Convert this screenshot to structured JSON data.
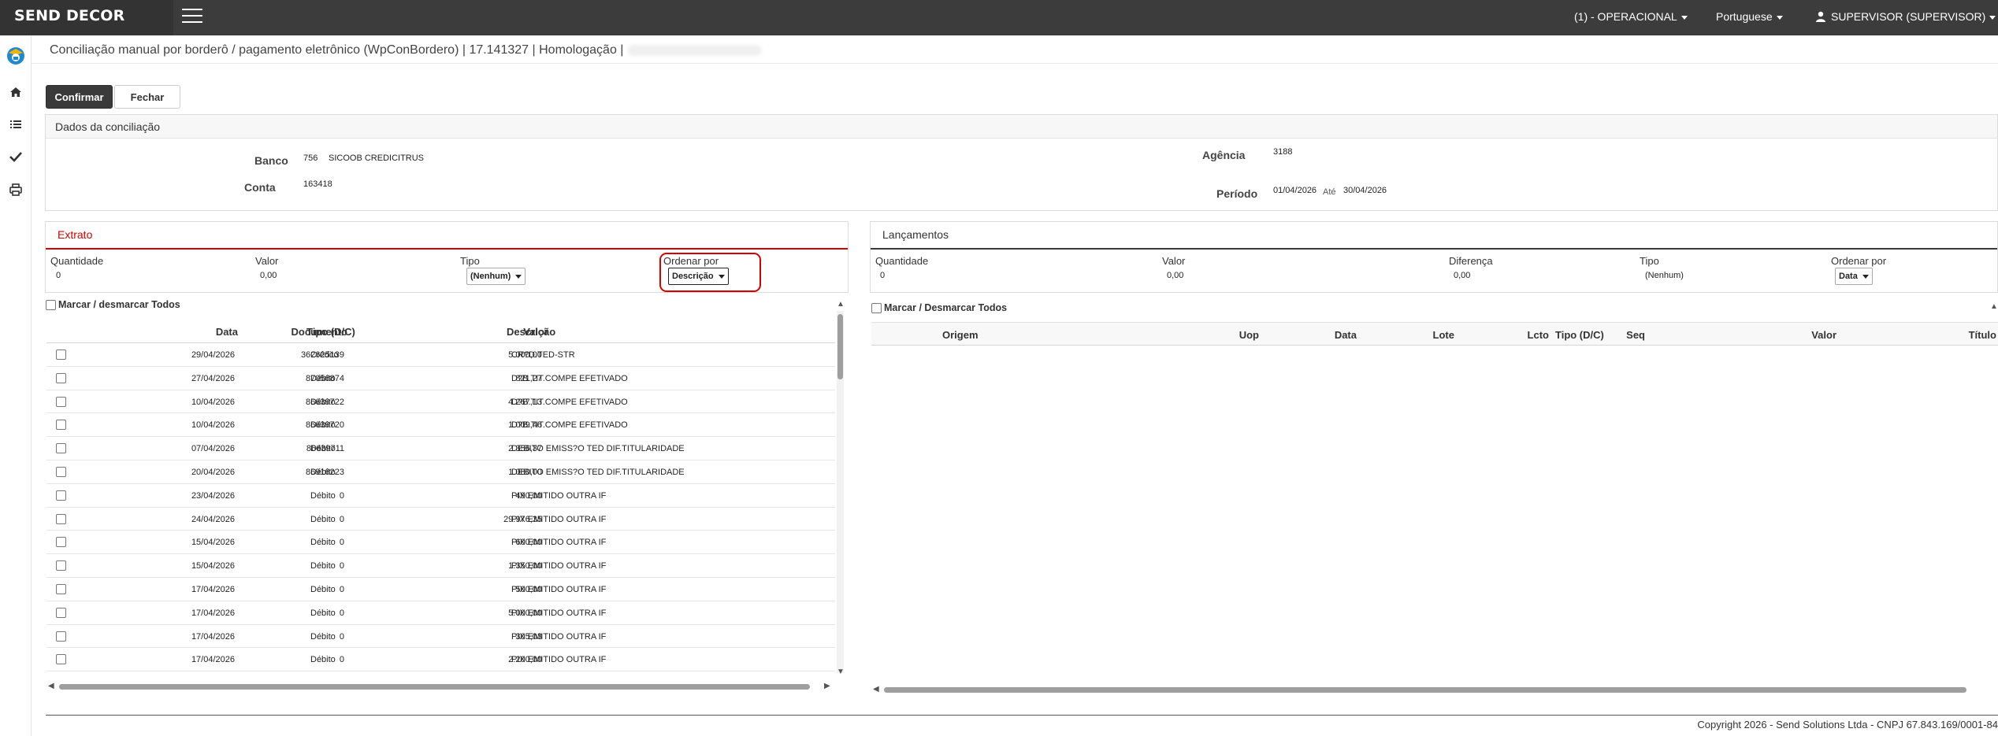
{
  "topbar": {
    "brand": "SEND DECOR",
    "operational_menu": "(1) - OPERACIONAL",
    "language_menu": "Portuguese",
    "user_menu": "SUPERVISOR (SUPERVISOR)"
  },
  "page": {
    "title": "Conciliação manual por borderô / pagamento eletrônico (WpConBordero) | 17.141327 | Homologação |"
  },
  "actions": {
    "confirm_label": "Confirmar",
    "close_label": "Fechar"
  },
  "conciliation": {
    "heading": "Dados da conciliação",
    "bank_label": "Banco",
    "bank_code": "756",
    "bank_name": "SICOOB CREDICITRUS",
    "account_label": "Conta",
    "account_value": "163418",
    "agency_label": "Agência",
    "agency_value": "3188",
    "period_label": "Período",
    "period_start": "01/04/2026",
    "period_until": "Até",
    "period_end": "30/04/2026"
  },
  "extrato": {
    "heading": "Extrato",
    "quantity_label": "Quantidade",
    "quantity_value": "0",
    "value_label": "Valor",
    "value_value": "0,00",
    "type_label": "Tipo",
    "type_selected": "(Nenhum)",
    "order_label": "Ordenar por",
    "order_selected": "Descrição",
    "toggle_all_label": "Marcar / desmarcar Todos",
    "columns": [
      "Data",
      "Documento",
      "Tipo (D/C)",
      "Valor",
      "Descrição"
    ],
    "rows": [
      {
        "date": "29/04/2026",
        "doc": "362625139",
        "type": "Crédito",
        "value": "5.000,00",
        "desc": "CR?D.TED-STR"
      },
      {
        "date": "27/04/2026",
        "doc": "87056874",
        "type": "Débito",
        "value": "821,27",
        "desc": "D?B.TIT.COMPE EFETIVADO"
      },
      {
        "date": "10/04/2026",
        "doc": "86639722",
        "type": "Débito",
        "value": "4.267,13",
        "desc": "D?B.TIT.COMPE EFETIVADO"
      },
      {
        "date": "10/04/2026",
        "doc": "86639720",
        "type": "Débito",
        "value": "1.009,46",
        "desc": "D?B.TIT.COMPE EFETIVADO"
      },
      {
        "date": "07/04/2026",
        "doc": "86639711",
        "type": "Débito",
        "value": "2.356,37",
        "desc": "DEBITO EMISS?O TED DIF.TITULARIDADE"
      },
      {
        "date": "20/04/2026",
        "doc": "86916223",
        "type": "Débito",
        "value": "1.080,00",
        "desc": "DEBITO EMISS?O TED DIF.TITULARIDADE"
      },
      {
        "date": "23/04/2026",
        "doc": "0",
        "type": "Débito",
        "value": "490,00",
        "desc": "PIX EMITIDO OUTRA IF"
      },
      {
        "date": "24/04/2026",
        "doc": "0",
        "type": "Débito",
        "value": "29.976,35",
        "desc": "PIX EMITIDO OUTRA IF"
      },
      {
        "date": "15/04/2026",
        "doc": "0",
        "type": "Débito",
        "value": "600,00",
        "desc": "PIX EMITIDO OUTRA IF"
      },
      {
        "date": "15/04/2026",
        "doc": "0",
        "type": "Débito",
        "value": "1.350,00",
        "desc": "PIX EMITIDO OUTRA IF"
      },
      {
        "date": "17/04/2026",
        "doc": "0",
        "type": "Débito",
        "value": "500,00",
        "desc": "PIX EMITIDO OUTRA IF"
      },
      {
        "date": "17/04/2026",
        "doc": "0",
        "type": "Débito",
        "value": "5.000,00",
        "desc": "PIX EMITIDO OUTRA IF"
      },
      {
        "date": "17/04/2026",
        "doc": "0",
        "type": "Débito",
        "value": "305,03",
        "desc": "PIX EMITIDO OUTRA IF"
      },
      {
        "date": "17/04/2026",
        "doc": "0",
        "type": "Débito",
        "value": "2.200,00",
        "desc": "PIX EMITIDO OUTRA IF"
      }
    ]
  },
  "lancamentos": {
    "heading": "Lançamentos",
    "quantity_label": "Quantidade",
    "quantity_value": "0",
    "value_label": "Valor",
    "value_value": "0,00",
    "difference_label": "Diferença",
    "difference_value": "0,00",
    "type_label": "Tipo",
    "type_value": "(Nenhum)",
    "order_label": "Ordenar por",
    "order_selected": "Data",
    "toggle_all_label": "Marcar / Desmarcar Todos",
    "columns": [
      "Origem",
      "Uop",
      "Data",
      "Lote",
      "Lcto",
      "Seq",
      "Tipo (D/C)",
      "Valor",
      "Título"
    ]
  },
  "footer": {
    "copyright": "Copyright 2026 - Send Solutions Ltda - CNPJ 67.843.169/0001-84"
  },
  "colors": {
    "topbar": "#3c3c3c",
    "accent_red": "#d90000",
    "dark_button": "#3a3a3a"
  }
}
